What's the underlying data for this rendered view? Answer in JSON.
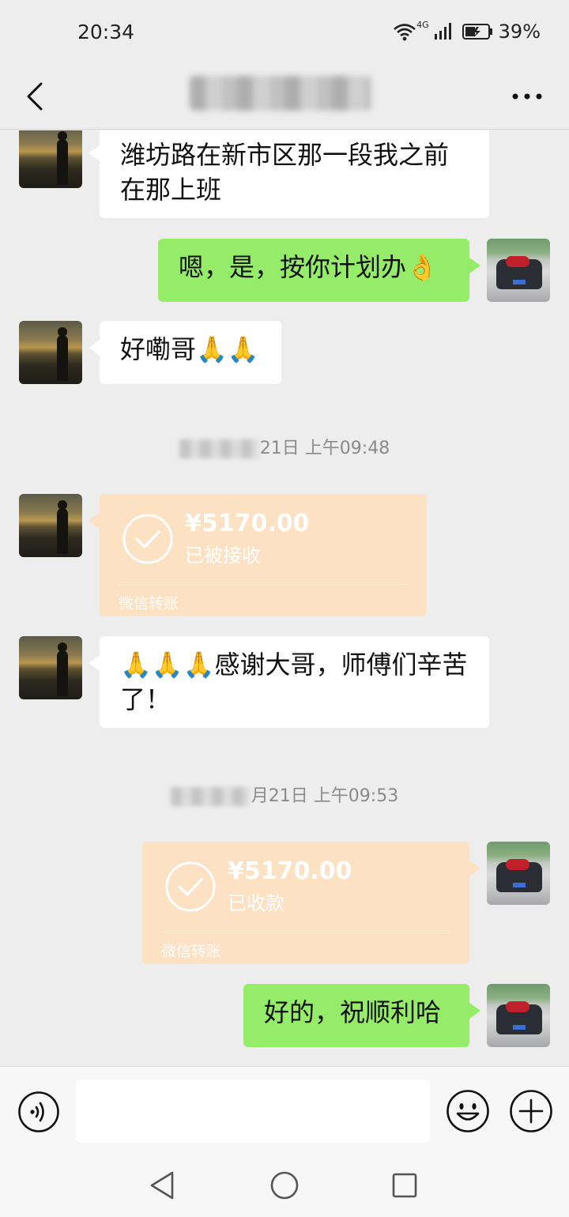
{
  "status_bar": {
    "time": "20:34",
    "network": "4G",
    "battery": "39%"
  },
  "header": {
    "title_obscured": true,
    "back_icon": "chevron-left-icon",
    "more_icon": "more-icon"
  },
  "messages": [
    {
      "side": "in",
      "type": "text",
      "text": "潍坊路在新市区那一段我之前在那上班"
    },
    {
      "side": "out",
      "type": "text",
      "text": "嗯，是，按你计划办",
      "emoji": "👌"
    },
    {
      "side": "in",
      "type": "text",
      "text": "好嘞哥",
      "emoji": "🙏🙏"
    },
    {
      "type": "timestamp",
      "text": "21日 上午09:48"
    },
    {
      "side": "in",
      "type": "transfer",
      "amount": "¥5170.00",
      "status": "已被接收",
      "brand": "微信转账"
    },
    {
      "side": "in",
      "type": "text",
      "emoji": "🙏🙏🙏",
      "text": "感谢大哥，师傅们辛苦了！"
    },
    {
      "type": "timestamp",
      "text": "月21日 上午09:53"
    },
    {
      "side": "out",
      "type": "transfer",
      "amount": "¥5170.00",
      "status": "已收款",
      "brand": "微信转账"
    },
    {
      "side": "out",
      "type": "text",
      "text": "好的，祝顺利哈"
    }
  ],
  "input": {
    "value": "",
    "placeholder": ""
  },
  "icons": {
    "voice": "voice-icon",
    "emoji": "emoji-smile-icon",
    "plus": "plus-icon",
    "nav_back": "nav-back-icon",
    "nav_home": "nav-home-icon",
    "nav_recent": "nav-recent-icon"
  },
  "colors": {
    "background": "#ededed",
    "outgoing_bubble": "#95ec69",
    "incoming_bubble": "#ffffff",
    "transfer_card": "#fde1c3"
  }
}
